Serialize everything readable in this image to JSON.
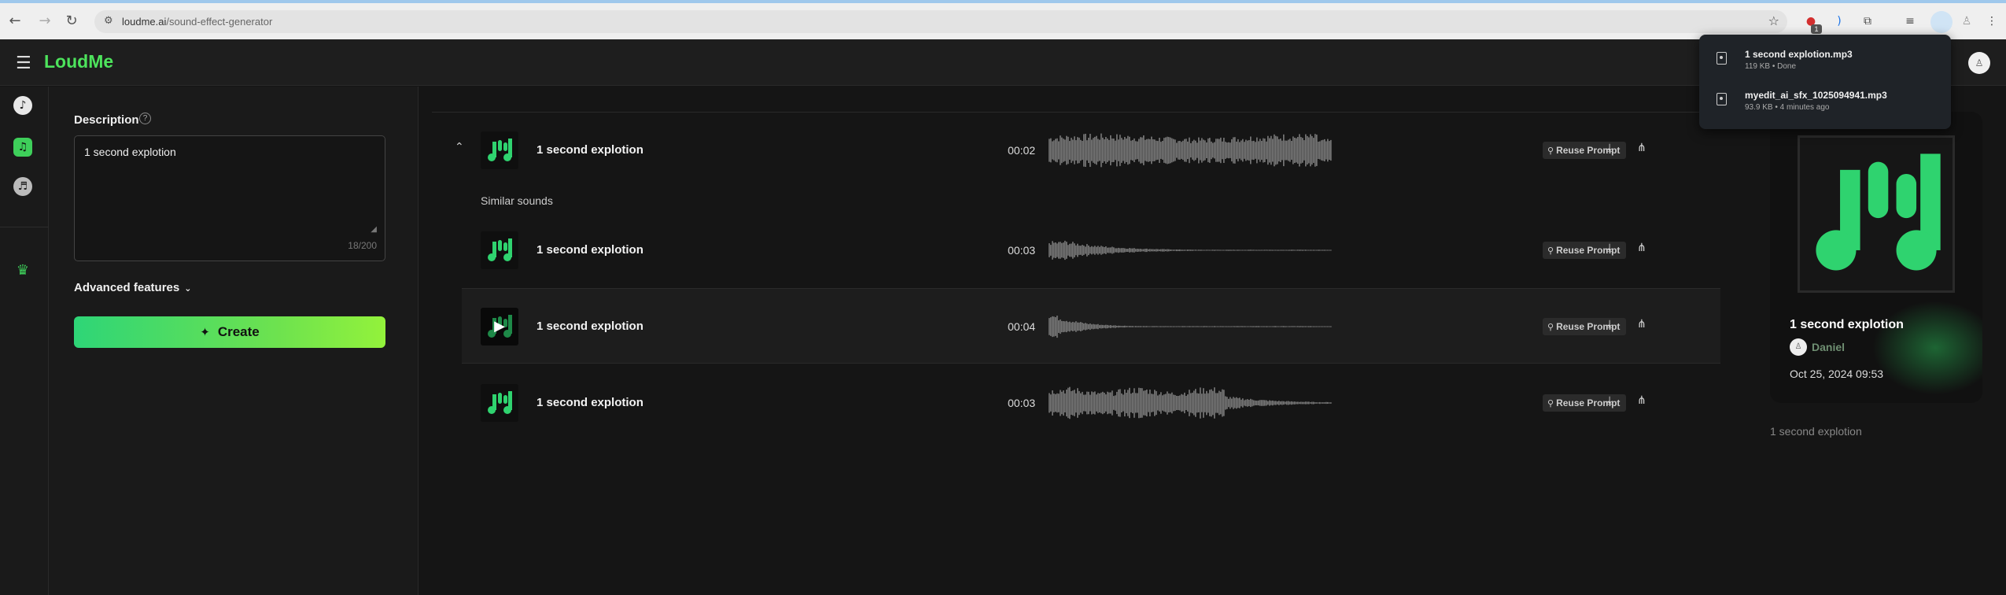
{
  "browser": {
    "url_host": "loudme.ai",
    "url_path": "/sound-effect-generator",
    "ext_badge": "1"
  },
  "downloads": [
    {
      "name": "1 second explotion.mp3",
      "meta": "119 KB • Done"
    },
    {
      "name": "myedit_ai_sfx_1025094941.mp3",
      "meta": "93.9 KB • 4 minutes ago"
    }
  ],
  "app": {
    "logo": "LoudMe"
  },
  "form": {
    "description_label": "Description",
    "description_value": "1 second explotion",
    "char_count": "18/200",
    "advanced_label": "Advanced features",
    "create_label": "Create"
  },
  "results": {
    "similar_label": "Similar sounds",
    "reuse_label": "Reuse Prompt",
    "rows": [
      {
        "title": "1 second explotion",
        "duration": "00:02"
      },
      {
        "title": "1 second explotion",
        "duration": "00:03"
      },
      {
        "title": "1 second explotion",
        "duration": "00:04"
      },
      {
        "title": "1 second explotion",
        "duration": "00:03"
      }
    ]
  },
  "now_playing": {
    "title": "1 second explotion",
    "author": "Daniel",
    "date": "Oct 25, 2024 09:53",
    "caption": "1 second explotion"
  },
  "colors": {
    "accent": "#4de35c",
    "waveform": "#7a7a7a"
  }
}
